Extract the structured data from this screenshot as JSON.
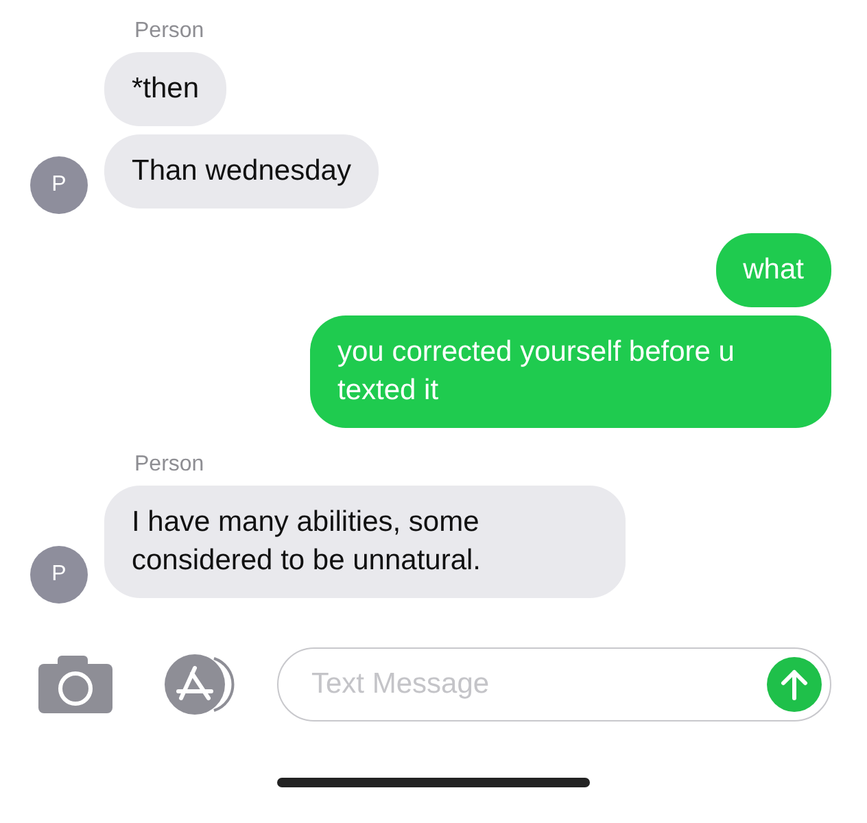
{
  "groups": [
    {
      "kind": "incoming",
      "sender": "Person",
      "avatar": "P",
      "messages": [
        "*then",
        "Than wednesday"
      ]
    },
    {
      "kind": "outgoing",
      "messages": [
        "what",
        "you corrected yourself before u texted it"
      ]
    },
    {
      "kind": "incoming",
      "sender": "Person",
      "avatar": "P",
      "messages": [
        "I have many abilities, some considered to be unnatural."
      ]
    }
  ],
  "composer": {
    "placeholder": "Text Message"
  }
}
